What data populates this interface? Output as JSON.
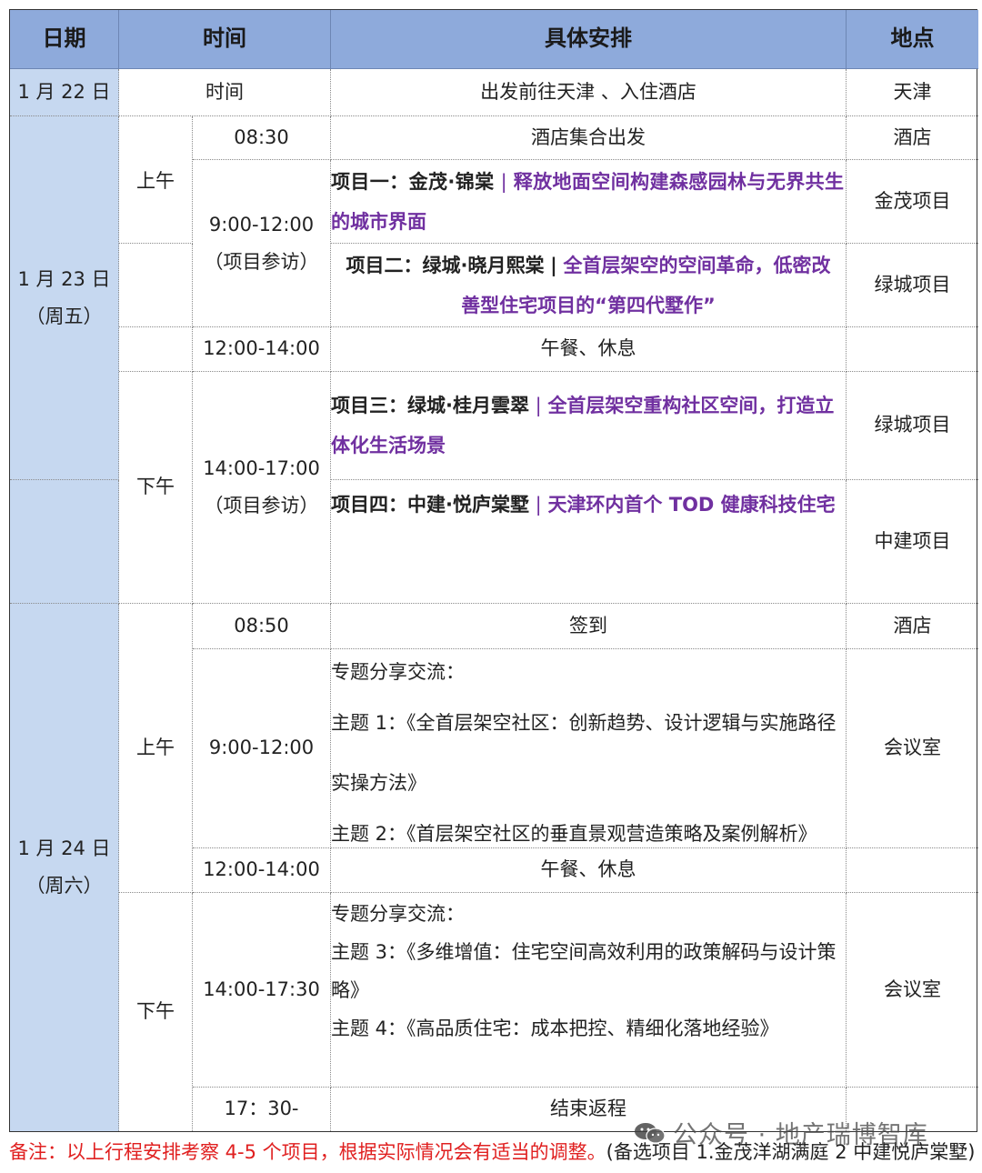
{
  "header": {
    "date": "日期",
    "time": "时间",
    "arrangement": "具体安排",
    "location": "地点"
  },
  "day1": {
    "date": "1 月 22 日",
    "time": "时间",
    "arrangement": "出发前往天津 、入住酒店",
    "location": "天津"
  },
  "day2": {
    "date": "1 月 23 日",
    "weekday": "（周五）",
    "am": "上午",
    "pm": "下午",
    "r1": {
      "time": "08:30",
      "arrangement": "酒店集合出发",
      "location": "酒店"
    },
    "visit_am": {
      "time": "9:00-12:00",
      "note": "（项目参访）"
    },
    "p1": {
      "label": "项目一：金茂·锦棠",
      "sep": "|",
      "desc": "释放地面空间构建森感园林与无界共生的城市界面",
      "location": "金茂项目"
    },
    "p2": {
      "label": "项目二：绿城·晓月熙棠",
      "sep": "|",
      "desc": "全首层架空的空间革命，低密改善型住宅项目的“第四代墅作”",
      "location": "绿城项目"
    },
    "lunch": {
      "time": "12:00-14:00",
      "arrangement": "午餐、休息"
    },
    "visit_pm": {
      "time": "14:00-17:00",
      "note": "（项目参访）"
    },
    "p3": {
      "label": "项目三：绿城·桂月雲翠",
      "sep": "|",
      "desc": "全首层架空重构社区空间，打造立体化生活场景",
      "location": "绿城项目"
    },
    "p4": {
      "label": "项目四：中建·悦庐棠墅",
      "sep": "|",
      "desc": "天津环内首个 TOD 健康科技住宅",
      "location": "中建项目"
    }
  },
  "day3": {
    "date": "1 月 24 日",
    "weekday": "（周六）",
    "am": "上午",
    "pm": "下午",
    "r1": {
      "time": "08:50",
      "arrangement": "签到",
      "location": "酒店"
    },
    "am_session": {
      "time": "9:00-12:00",
      "intro": "专题分享交流：",
      "topic1": "主题 1：《全首层架空社区：创新趋势、设计逻辑与实施路径实操方法》",
      "topic2": "主题 2：《首层架空社区的垂直景观营造策略及案例解析》",
      "location": "会议室"
    },
    "lunch": {
      "time": "12:00-14:00",
      "arrangement": "午餐、休息"
    },
    "pm_session": {
      "time": "14:00-17:30",
      "intro": "专题分享交流：",
      "topic3": "主题 3：《多维增值：住宅空间高效利用的政策解码与设计策略》",
      "topic4": "主题 4：《高品质住宅：成本把控、精细化落地经验》",
      "location": "会议室"
    },
    "end": {
      "time": "17：30-",
      "arrangement": "结束返程"
    }
  },
  "footnote": {
    "red": "备注：以上行程安排考察 4-5 个项目，根据实际情况会有适当的调整。",
    "black": "(备选项目 1.金茂洋湖满庭 2 中建悦庐棠墅)"
  },
  "watermark": "公众号 · 地产瑞博智库"
}
